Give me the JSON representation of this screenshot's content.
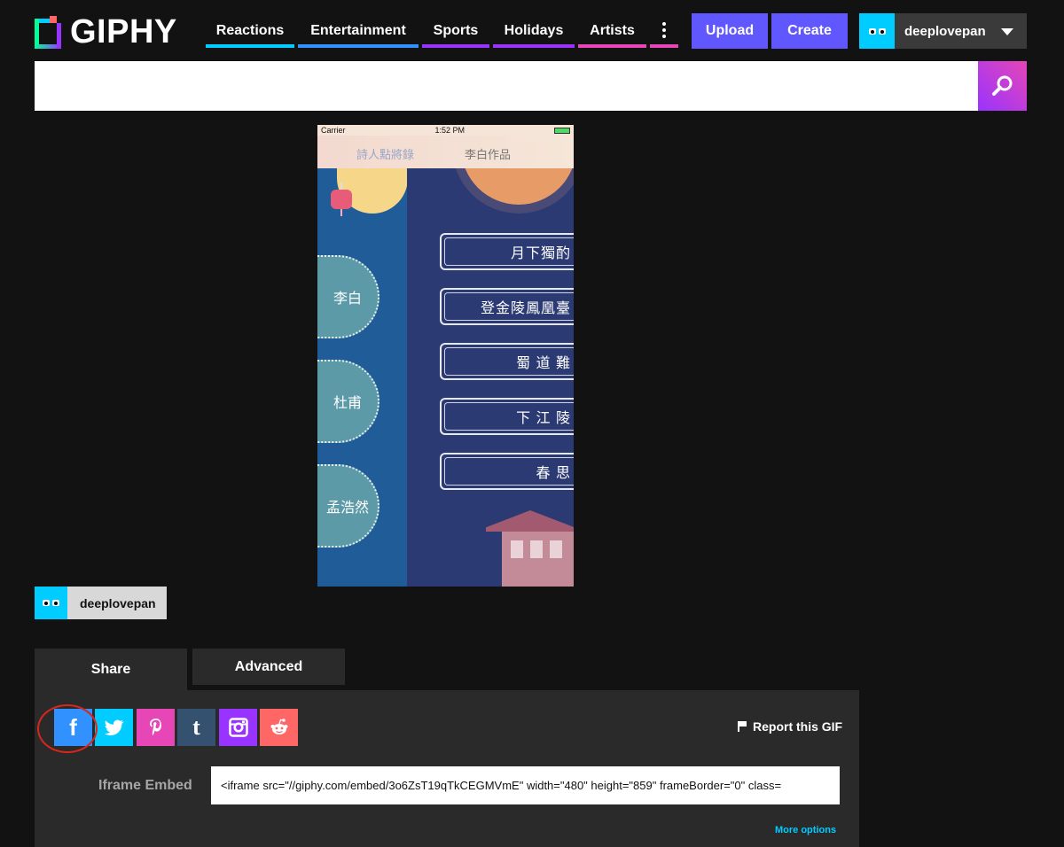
{
  "header": {
    "logo_text": "GIPHY",
    "nav": [
      {
        "label": "Reactions",
        "color": "#00ccff"
      },
      {
        "label": "Entertainment",
        "color": "#3191ff"
      },
      {
        "label": "Sports",
        "color": "#9933ff"
      },
      {
        "label": "Holidays",
        "color": "#9933ff"
      },
      {
        "label": "Artists",
        "color": "#e646b6"
      }
    ],
    "more_icon": "vertical-dots-icon",
    "upload_label": "Upload",
    "create_label": "Create",
    "username": "deeplovepan",
    "dropdown_icon": "caret-down-icon"
  },
  "search": {
    "placeholder": "",
    "icon": "search-icon"
  },
  "gif": {
    "status_carrier": "Carrier",
    "status_time": "1:52 PM",
    "nav_title_left": "詩人點將錄",
    "nav_title_right": "李白作品",
    "poets": [
      "李白",
      "杜甫",
      "孟浩然"
    ],
    "poems": [
      "月下獨酌",
      "登金陵鳳凰臺",
      "蜀 道 難",
      "下 江 陵",
      "春 思"
    ]
  },
  "uploader": {
    "username": "deeplovepan"
  },
  "tabs": {
    "share_label": "Share",
    "advanced_label": "Advanced"
  },
  "share": {
    "networks": [
      {
        "name": "facebook",
        "glyph": "f",
        "color": "#3191ff",
        "icon": "facebook-icon"
      },
      {
        "name": "twitter",
        "glyph": "🐦",
        "color": "#00ccff",
        "icon": "twitter-icon"
      },
      {
        "name": "pinterest",
        "glyph": "P",
        "color": "#e646b6",
        "icon": "pinterest-icon"
      },
      {
        "name": "tumblr",
        "glyph": "t",
        "color": "#34526f",
        "icon": "tumblr-icon"
      },
      {
        "name": "instagram",
        "glyph": "◎",
        "color": "#9933ff",
        "icon": "instagram-icon"
      },
      {
        "name": "reddit",
        "glyph": "◉",
        "color": "#ff6666",
        "icon": "reddit-icon"
      }
    ],
    "report_label": "Report this GIF",
    "embed_label": "Iframe Embed",
    "embed_value": "<iframe src=\"//giphy.com/embed/3o6ZsT19qTkCEGMVmE\" width=\"480\" height=\"859\" frameBorder=\"0\" class=",
    "more_options_label": "More options"
  },
  "colors": {
    "background": "#121212",
    "accent_purple": "#6157ff",
    "panel": "#2a2a2a",
    "highlight_circle": "#d9261c"
  }
}
